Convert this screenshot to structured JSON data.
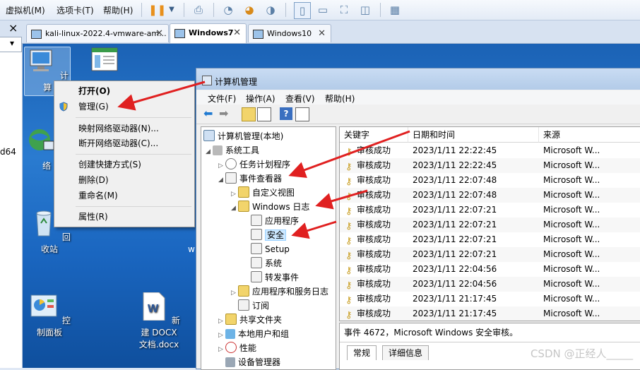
{
  "vm_menu": {
    "virtual_machine": "虚拟机(M)",
    "tab": "选项卡(T)",
    "help": "帮助(H)"
  },
  "tabs": [
    {
      "label": "kali-linux-2022.4-vmware-am...",
      "active": false
    },
    {
      "label": "Windows7",
      "active": true
    },
    {
      "label": "Windows10",
      "active": false
    }
  ],
  "sidebar": {
    "close": "×",
    "dropdown": "▾",
    "partial_text": "d64"
  },
  "desktop_icons": [
    {
      "label": "计算"
    },
    {
      "label": "网络"
    },
    {
      "label": "回收站"
    },
    {
      "label": "控制面板"
    },
    {
      "label": "新建 DOCX\n文档.docx"
    }
  ],
  "context_menu": {
    "items": [
      "打开(O)",
      "管理(G)",
      "映射网络驱动器(N)...",
      "断开网络驱动器(C)...",
      "创建快捷方式(S)",
      "删除(D)",
      "重命名(M)",
      "属性(R)"
    ]
  },
  "cm": {
    "title": "计算机管理",
    "menu": [
      "文件(F)",
      "操作(A)",
      "查看(V)",
      "帮助(H)"
    ],
    "tree": [
      "计算机管理(本地)",
      "系统工具",
      "任务计划程序",
      "事件查看器",
      "自定义视图",
      "Windows 日志",
      "应用程序",
      "安全",
      "Setup",
      "系统",
      "转发事件",
      "应用程序和服务日志",
      "订阅",
      "共享文件夹",
      "本地用户和组",
      "性能",
      "设备管理器"
    ],
    "columns": [
      "关键字",
      "日期和时间",
      "来源"
    ],
    "rows": [
      [
        "审核成功",
        "2023/1/11 22:22:45",
        "Microsoft W..."
      ],
      [
        "审核成功",
        "2023/1/11 22:22:45",
        "Microsoft W..."
      ],
      [
        "审核成功",
        "2023/1/11 22:07:48",
        "Microsoft W..."
      ],
      [
        "审核成功",
        "2023/1/11 22:07:48",
        "Microsoft W..."
      ],
      [
        "审核成功",
        "2023/1/11 22:07:21",
        "Microsoft W..."
      ],
      [
        "审核成功",
        "2023/1/11 22:07:21",
        "Microsoft W..."
      ],
      [
        "审核成功",
        "2023/1/11 22:07:21",
        "Microsoft W..."
      ],
      [
        "审核成功",
        "2023/1/11 22:07:21",
        "Microsoft W..."
      ],
      [
        "审核成功",
        "2023/1/11 22:04:56",
        "Microsoft W..."
      ],
      [
        "审核成功",
        "2023/1/11 22:04:56",
        "Microsoft W..."
      ],
      [
        "审核成功",
        "2023/1/11 21:17:45",
        "Microsoft W..."
      ],
      [
        "审核成功",
        "2023/1/11 21:17:45",
        "Microsoft W..."
      ]
    ],
    "detail_title": "事件 4672，Microsoft Windows 安全审核。",
    "detail_tabs": [
      "常规",
      "详细信息"
    ]
  },
  "desktop_partial": "w",
  "watermark": "CSDN @正经人_____",
  "colors": {
    "arrow": "#e02020",
    "desktop": "#1e6cc4"
  }
}
